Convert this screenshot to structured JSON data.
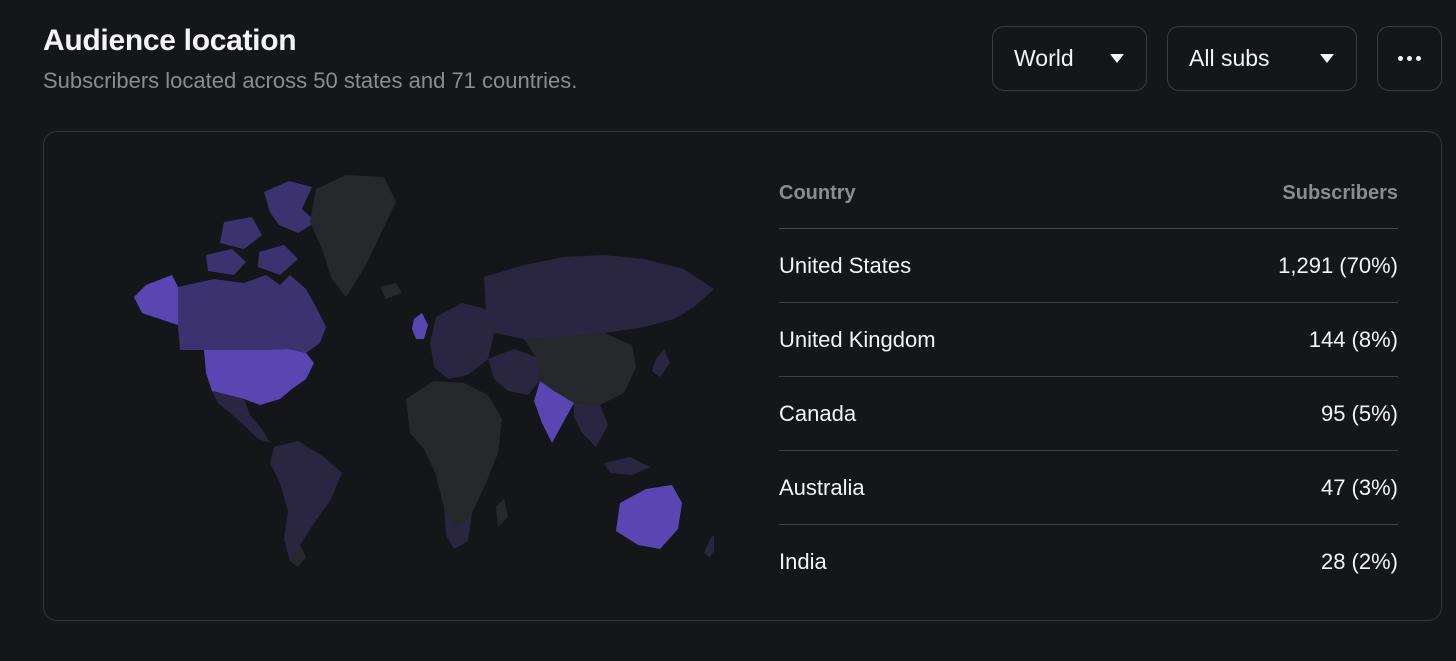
{
  "header": {
    "title": "Audience location",
    "subtitle": "Subscribers located across 50 states and 71 countries."
  },
  "controls": {
    "region_select": "World",
    "subs_select": "All subs"
  },
  "colors": {
    "accent_strong": "#5a46b3",
    "accent_mid": "#3c3270",
    "accent_low": "#2a2540",
    "land_default": "#27282b"
  },
  "table": {
    "headers": {
      "country": "Country",
      "subscribers": "Subscribers"
    },
    "rows": [
      {
        "country": "United States",
        "subscribers": "1,291 (70%)"
      },
      {
        "country": "United Kingdom",
        "subscribers": "144 (8%)"
      },
      {
        "country": "Canada",
        "subscribers": "95 (5%)"
      },
      {
        "country": "Australia",
        "subscribers": "47 (3%)"
      },
      {
        "country": "India",
        "subscribers": "28 (2%)"
      }
    ]
  }
}
